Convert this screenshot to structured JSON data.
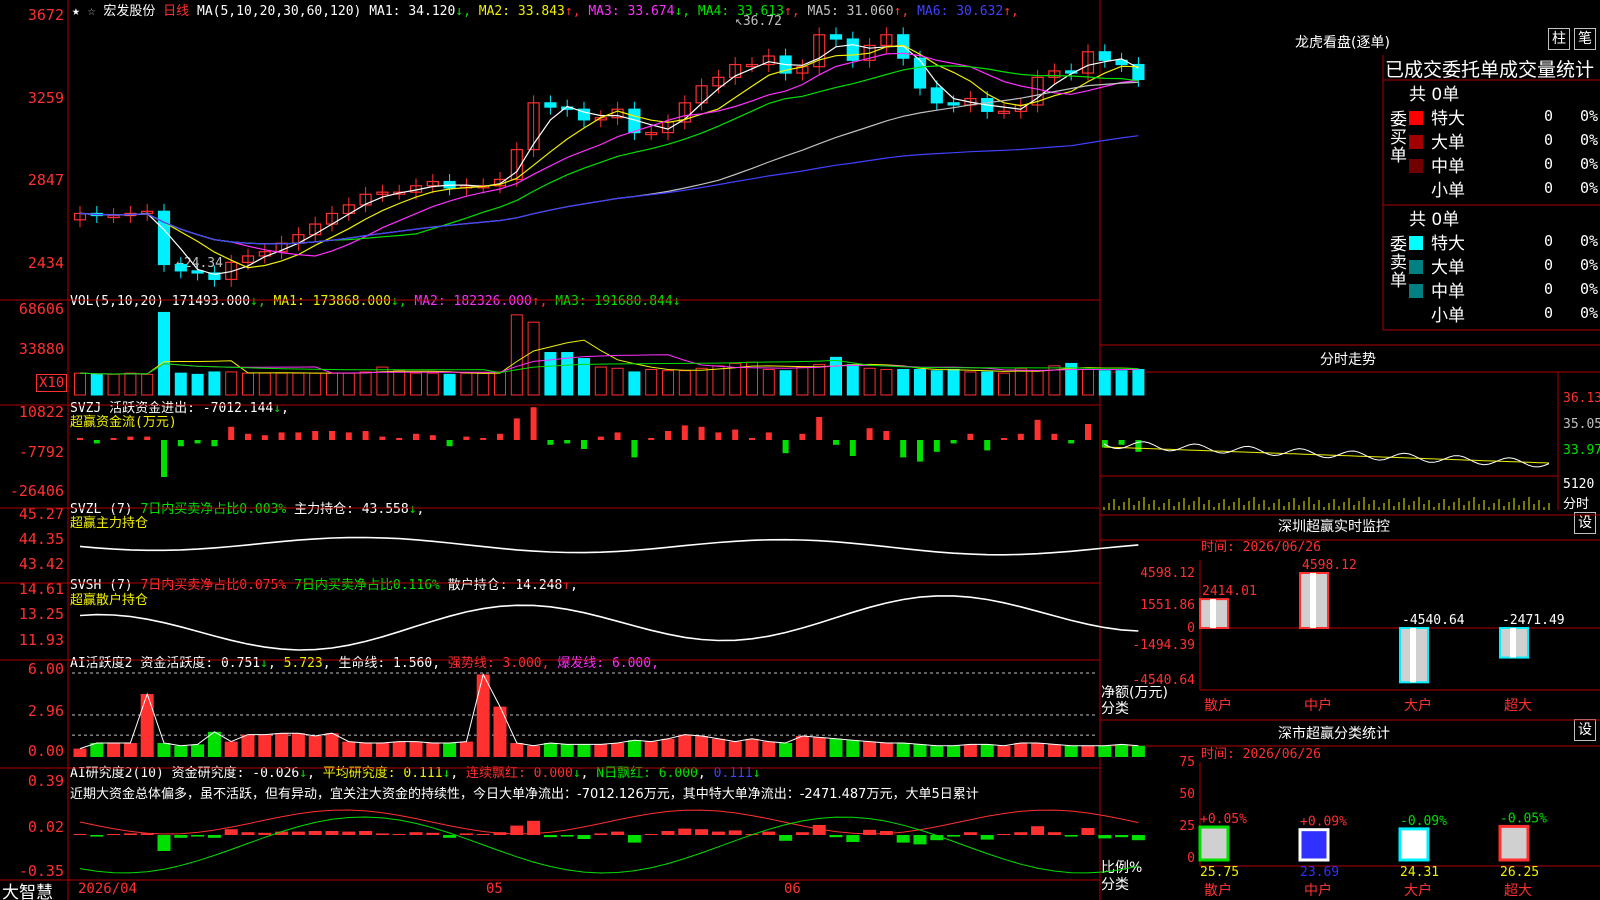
{
  "colors": {
    "bg": "#000000",
    "frame": "#b00000",
    "up": "#ff3030",
    "down": "#00f0ff",
    "ma1": "#ffffff",
    "ma2": "#f0f000",
    "ma3": "#ff30ff",
    "ma4": "#00e000",
    "ma5": "#c0c0c0",
    "ma6": "#4040ff",
    "green": "#00e000"
  },
  "stock": {
    "name": "宏发股份",
    "period": "日线",
    "ma_params": "MA(5,10,20,30,60,120)",
    "ma_legend": [
      {
        "label": "MA1: 34.120",
        "arrow": "↓",
        "color": "#ffffff"
      },
      {
        "label": "MA2: 33.843",
        "arrow": "↑",
        "color": "#f0f000"
      },
      {
        "label": "MA3: 33.674",
        "arrow": "↓",
        "color": "#ff30ff"
      },
      {
        "label": "MA4: 33.613",
        "arrow": "↑",
        "color": "#00e000"
      },
      {
        "label": "MA5: 31.060",
        "arrow": "↑",
        "color": "#c0c0c0"
      },
      {
        "label": "MA6: 30.632",
        "arrow": "↑",
        "color": "#4040ff"
      }
    ],
    "high_mark": "36.72",
    "low_mark": "24.34",
    "price_ticks": [
      "3672",
      "3259",
      "2847",
      "2434"
    ],
    "price_range": [
      24.0,
      37.4
    ]
  },
  "panels": {
    "vol": {
      "title": "VOL(5,10,20)",
      "value": "171493.000",
      "ma1": "MA1: 173868.000",
      "ma2": "MA2: 182326.000",
      "ma3": "MA3: 191680.844",
      "ticks": [
        "68606",
        "33880"
      ],
      "unit": "X10"
    },
    "svzj": {
      "title": "SVZJ",
      "text": "活跃资金进出: -7012.144",
      "sub": "超赢资金流(万元)",
      "ticks": [
        "10822",
        "-7792",
        "-26406"
      ]
    },
    "svzl": {
      "title": "SVZL (7)",
      "t1": "7日内买卖净占比0.003%",
      "t2": "主力持仓: 43.558",
      "sub": "超赢主力持仓",
      "ticks": [
        "45.27",
        "44.35",
        "43.42"
      ]
    },
    "svsh": {
      "title": "SVSH (7)",
      "t1": "7日内买卖净占比0.075%",
      "t2": "7日内买卖净占比0.116%",
      "t3": "散户持仓: 14.248",
      "sub": "超赢散户持仓",
      "ticks": [
        "14.61",
        "13.25",
        "11.93"
      ]
    },
    "ai1": {
      "title": "AI活跃度2",
      "t1": "资金活跃度: 0.751",
      "t2": "5.723",
      "t3": "生命线: 1.560",
      "t4": "强势线: 3.000",
      "t5": "爆发线: 6.000",
      "ticks": [
        "6.00",
        "2.96",
        "0.00"
      ]
    },
    "ai2": {
      "title": "AI研究度2(10)",
      "t1": "资金研究度: -0.026",
      "t2": "平均研究度: 0.111",
      "t3": "连续飘红: 0.000",
      "t4": "N日飘红: 6.000",
      "t5": "0.111",
      "ticks": [
        "0.39",
        "0.02",
        "-0.35"
      ],
      "comment": "近期大资金总体偏多，虽不活跃，但有异动，宜关注大资金的持续性，今日大单净流出：-7012.126万元，其中特大单净流出：-2471.487万元，大单5日累计"
    }
  },
  "footer": {
    "brand": "大智慧",
    "date_label": "2026/04",
    "month1": "05",
    "month2": "06"
  },
  "right": {
    "dragon": {
      "title": "龙虎看盘(逐单)",
      "btn1": "柱",
      "btn2": "笔",
      "subtitle": "已成交委托单成交量统计",
      "buy_label": "委买单",
      "sell_label": "委卖单",
      "buy_total": "共 0单",
      "sell_total": "共 0单",
      "buy_rows": [
        {
          "label": "特大",
          "n": "0",
          "p": "0%",
          "color": "#ff0000"
        },
        {
          "label": "大单",
          "n": "0",
          "p": "0%",
          "color": "#a00000"
        },
        {
          "label": "中单",
          "n": "0",
          "p": "0%",
          "color": "#700000"
        },
        {
          "label": "小单",
          "n": "0",
          "p": "0%",
          "color": ""
        }
      ],
      "sell_rows": [
        {
          "label": "特大",
          "n": "0",
          "p": "0%",
          "color": "#00ffff"
        },
        {
          "label": "大单",
          "n": "0",
          "p": "0%",
          "color": "#008080"
        },
        {
          "label": "中单",
          "n": "0",
          "p": "0%",
          "color": "#008080"
        },
        {
          "label": "小单",
          "n": "0",
          "p": "0%",
          "color": ""
        }
      ]
    },
    "intraday": {
      "title": "分时走势",
      "ticks": [
        "36.13",
        "35.05",
        "33.97"
      ],
      "vol_tick": "5120",
      "vol_label": "分时"
    },
    "shenzhen_monitor": {
      "title": "深圳超赢实时监控",
      "btn": "设",
      "time": "时间: 2026/06/26",
      "yticks": [
        "4598.12",
        "1551.86",
        "0",
        "-1494.39",
        "-4540.64"
      ],
      "ylabel": "净额(万元)",
      "xlabel": "分类",
      "bars": [
        {
          "cat": "散户",
          "value": 2414.01,
          "label": "2414.01"
        },
        {
          "cat": "中户",
          "value": 4598.12,
          "label": "4598.12"
        },
        {
          "cat": "大户",
          "value": -4540.64,
          "label": "-4540.64"
        },
        {
          "cat": "超大",
          "value": -2471.49,
          "label": "-2471.49"
        }
      ]
    },
    "shenzhen_class": {
      "title": "深市超赢分类统计",
      "btn": "设",
      "time": "时间: 2026/06/26",
      "yticks": [
        "75",
        "50",
        "25",
        "0"
      ],
      "ylabel": "比例%",
      "xlabel": "分类",
      "bars": [
        {
          "cat": "散户",
          "value": 25.75,
          "label": "25.75",
          "change": "+0.05%"
        },
        {
          "cat": "中户",
          "value": 23.69,
          "label": "23.69",
          "change": "+0.09%"
        },
        {
          "cat": "大户",
          "value": 24.31,
          "label": "24.31",
          "change": "-0.09%"
        },
        {
          "cat": "超大",
          "value": 26.25,
          "label": "26.25",
          "change": "-0.05%"
        }
      ]
    }
  },
  "chart_data": [
    {
      "type": "candlestick",
      "title": "宏发股份 日线",
      "x": [
        "2026/04",
        "05",
        "06"
      ],
      "ylim": [
        24.34,
        36.72
      ],
      "high": 36.72,
      "low": 24.34,
      "closes": [
        27.6,
        27.5,
        27.5,
        27.6,
        27.7,
        25.2,
        24.9,
        24.8,
        24.5,
        25.3,
        25.6,
        25.8,
        26.2,
        26.6,
        27.1,
        27.6,
        28.0,
        28.5,
        28.6,
        28.6,
        28.9,
        29.1,
        28.8,
        28.9,
        28.9,
        29.2,
        30.6,
        32.8,
        32.6,
        32.5,
        32.0,
        32.1,
        32.5,
        31.4,
        31.4,
        31.9,
        32.8,
        33.6,
        34.0,
        34.6,
        34.6,
        35.0,
        34.2,
        34.5,
        36.0,
        35.8,
        34.8,
        35.5,
        36.0,
        34.9,
        33.5,
        32.8,
        32.7,
        33.0,
        32.4,
        32.4,
        32.7,
        34.0,
        34.3,
        34.2,
        35.2,
        34.8,
        34.6,
        33.9
      ]
    },
    {
      "type": "bar",
      "title": "VOL(5,10,20)",
      "ylim": [
        0,
        68606
      ],
      "values": [
        18,
        17,
        17,
        18,
        17,
        68,
        18,
        17,
        19,
        19,
        18,
        18,
        18,
        18,
        18,
        18,
        18,
        19,
        23,
        20,
        18,
        18,
        17,
        18,
        18,
        19,
        66,
        60,
        35,
        35,
        30,
        23,
        22,
        19,
        21,
        20,
        20,
        22,
        24,
        26,
        27,
        21,
        20,
        23,
        25,
        31,
        25,
        22,
        21,
        21,
        21,
        20,
        21,
        19,
        19,
        18,
        22,
        20,
        24,
        26,
        21,
        20,
        20,
        21
      ]
    },
    {
      "type": "bar",
      "title": "AI活跃度2",
      "ylim": [
        0,
        6
      ],
      "values": [
        0.6,
        1.0,
        1.0,
        1.0,
        4.5,
        1.0,
        0.8,
        0.9,
        1.8,
        1.1,
        1.6,
        1.6,
        1.7,
        1.7,
        1.5,
        1.7,
        1.1,
        1.0,
        1.0,
        1.1,
        1.1,
        1.0,
        1.0,
        1.1,
        5.9,
        3.6,
        1.0,
        0.8,
        1.0,
        0.9,
        0.9,
        0.9,
        1.0,
        1.2,
        1.1,
        1.3,
        1.6,
        1.5,
        1.3,
        1.1,
        1.3,
        1.1,
        1.0,
        1.5,
        1.4,
        1.3,
        1.2,
        1.1,
        1.0,
        1.0,
        0.9,
        0.8,
        0.8,
        0.9,
        0.9,
        0.8,
        1.0,
        1.0,
        0.9,
        0.8,
        0.8,
        0.8,
        0.9,
        0.8
      ]
    },
    {
      "type": "bar",
      "title": "深圳超赢实时监控",
      "categories": [
        "散户",
        "中户",
        "大户",
        "超大"
      ],
      "values": [
        2414.01,
        4598.12,
        -4540.64,
        -2471.49
      ],
      "ylabel": "净额(万元)",
      "ylim": [
        -4540.64,
        4598.12
      ]
    },
    {
      "type": "bar",
      "title": "深市超赢分类统计",
      "categories": [
        "散户",
        "中户",
        "大户",
        "超大"
      ],
      "values": [
        25.75,
        23.69,
        24.31,
        26.25
      ],
      "ylabel": "比例%",
      "ylim": [
        0,
        75
      ]
    }
  ]
}
